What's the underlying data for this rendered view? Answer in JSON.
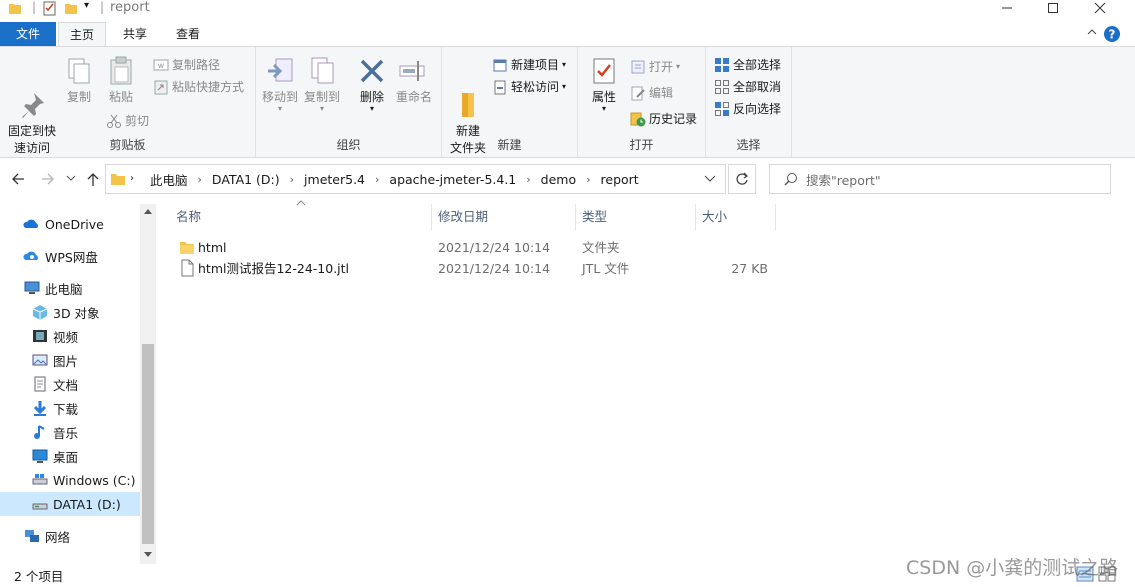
{
  "window": {
    "title": "report"
  },
  "ribbon_tabs": [
    "文件",
    "主页",
    "共享",
    "查看"
  ],
  "ribbon": {
    "clipboard": {
      "label": "剪贴板",
      "pin": "固定到快\n速访问",
      "copy": "复制",
      "paste": "粘贴",
      "copy_path": "复制路径",
      "paste_shortcut": "粘贴快捷方式",
      "cut": "剪切"
    },
    "organize": {
      "label": "组织",
      "move_to": "移动到",
      "copy_to": "复制到",
      "delete": "删除",
      "rename": "重命名"
    },
    "new": {
      "label": "新建",
      "new_folder": "新建\n文件夹",
      "new_item": "新建项目",
      "easy_access": "轻松访问"
    },
    "open": {
      "label": "打开",
      "properties": "属性",
      "open": "打开",
      "edit": "编辑",
      "history": "历史记录"
    },
    "select": {
      "label": "选择",
      "select_all": "全部选择",
      "select_none": "全部取消",
      "invert": "反向选择"
    }
  },
  "address": {
    "crumbs": [
      "此电脑",
      "DATA1 (D:)",
      "jmeter5.4",
      "apache-jmeter-5.4.1",
      "demo",
      "report"
    ]
  },
  "search": {
    "placeholder": "搜索\"report\""
  },
  "nav": [
    {
      "label": "OneDrive",
      "icon": "cloud-icon"
    },
    {
      "label": "WPS网盘",
      "icon": "wps-cloud-icon"
    },
    {
      "label": "此电脑",
      "icon": "computer-icon"
    },
    {
      "label": "3D 对象",
      "icon": "cube-icon"
    },
    {
      "label": "视频",
      "icon": "video-icon"
    },
    {
      "label": "图片",
      "icon": "picture-icon"
    },
    {
      "label": "文档",
      "icon": "document-icon"
    },
    {
      "label": "下载",
      "icon": "download-icon"
    },
    {
      "label": "音乐",
      "icon": "music-icon"
    },
    {
      "label": "桌面",
      "icon": "desktop-icon"
    },
    {
      "label": "Windows (C:)",
      "icon": "drive-icon"
    },
    {
      "label": "DATA1 (D:)",
      "icon": "drive-icon",
      "selected": true
    },
    {
      "label": "网络",
      "icon": "network-icon"
    }
  ],
  "columns": [
    "名称",
    "修改日期",
    "类型",
    "大小"
  ],
  "files": [
    {
      "name": "html",
      "date": "2021/12/24 10:14",
      "type": "文件夹",
      "size": "",
      "icon": "folder-icon"
    },
    {
      "name": "html测试报告12-24-10.jtl",
      "date": "2021/12/24 10:14",
      "type": "JTL 文件",
      "size": "27 KB",
      "icon": "file-icon"
    }
  ],
  "status": {
    "count": "2 个项目"
  },
  "watermark": "CSDN @小龚的测试之路",
  "colors": {
    "accent": "#1a6fc9",
    "selected": "#cce8ff",
    "folder": "#f4c34a"
  }
}
